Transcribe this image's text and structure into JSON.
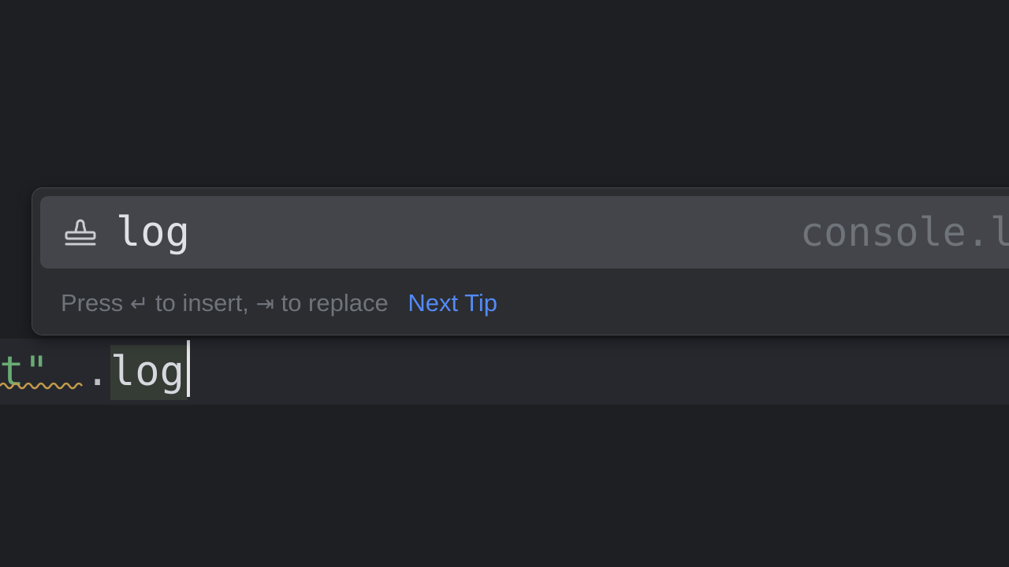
{
  "editor": {
    "string_tail": "rt\"",
    "dot": ".",
    "typed_text": "log"
  },
  "completion": {
    "item": {
      "icon": "template-stamp-icon",
      "label": "log",
      "detail": "console.log"
    },
    "footer": {
      "press": "Press",
      "enter_glyph": "↵",
      "to_insert": "to insert,",
      "tab_glyph": "⇥",
      "to_replace": "to replace",
      "next_tip": "Next Tip"
    }
  },
  "colors": {
    "background": "#1e1f22",
    "string": "#6aab73",
    "link": "#548af7",
    "selected_item": "#43454a"
  }
}
